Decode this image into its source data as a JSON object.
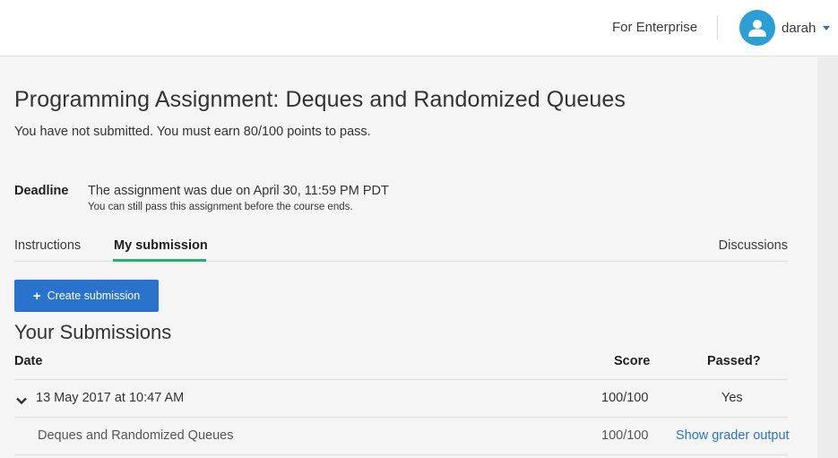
{
  "header": {
    "enterprise_link": "For Enterprise",
    "username": "darah"
  },
  "assignment": {
    "title": "Programming Assignment: Deques and Randomized Queues",
    "pass_requirement": "You have not submitted. You must earn 80/100 points to pass.",
    "deadline_label": "Deadline",
    "deadline_text": "The assignment was due on April 30, 11:59 PM PDT",
    "deadline_note": "You can still pass this assignment before the course ends."
  },
  "tabs": [
    {
      "label": "Instructions",
      "active": false
    },
    {
      "label": "My submission",
      "active": true
    },
    {
      "label": "Discussions",
      "active": false
    }
  ],
  "create_button": "Create submission",
  "submissions": {
    "title": "Your Submissions",
    "columns": {
      "date": "Date",
      "score": "Score",
      "passed": "Passed?"
    },
    "rows": [
      {
        "date": "13 May 2017 at 10:47 AM",
        "score": "100/100",
        "passed": "Yes",
        "expanded": true,
        "parts": [
          {
            "name": "Deques and Randomized Queues",
            "score": "100/100",
            "link": "Show grader output"
          }
        ]
      }
    ]
  },
  "colors": {
    "accent": "#2a73cc",
    "tab_underline": "#1fb36b",
    "avatar": "#2a9fd6"
  }
}
